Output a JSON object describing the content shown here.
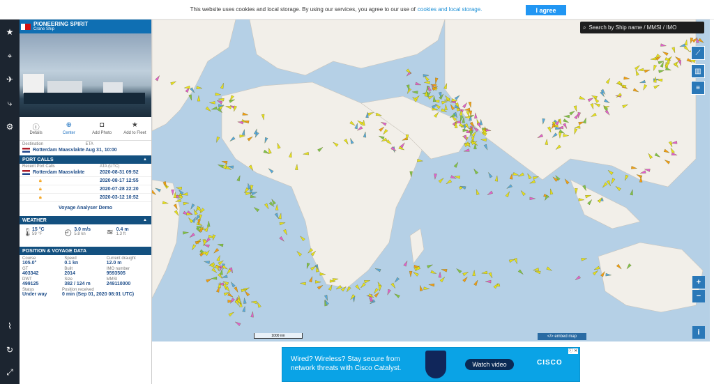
{
  "cookie": {
    "text": "This website uses cookies and local storage. By using our services, you agree to our use of",
    "link": "cookies and local storage.",
    "button": "I agree"
  },
  "left_nav": {
    "icons": [
      "star-icon",
      "location-pin-icon",
      "satellite-icon",
      "route-icon",
      "gear-icon",
      "antenna-icon",
      "refresh-icon",
      "expand-icon"
    ]
  },
  "ship": {
    "name": "PIONEERING SPIRIT",
    "type": "Crane Ship",
    "flag_color": "#d01010"
  },
  "tabs": [
    {
      "label": "Details",
      "icon": "info-icon"
    },
    {
      "label": "Center",
      "icon": "crosshair-icon"
    },
    {
      "label": "Add Photo",
      "icon": "camera-icon"
    },
    {
      "label": "Add to Fleet",
      "icon": "star-icon"
    }
  ],
  "destination": {
    "dest_label": "Destination",
    "eta_label": "ETA",
    "dest_value": "Rotterdam Maasvlakte",
    "eta_value": "Aug 31, 10:00"
  },
  "port_calls": {
    "title": "PORT CALLS",
    "col_port": "Recent Port Calls",
    "col_ata": "ATA (UTC)",
    "rows": [
      {
        "port": "Rotterdam Maasvlakte",
        "time": "2020-08-31 09:52"
      },
      {
        "port": "",
        "time": "2020-08-17 12:55"
      },
      {
        "port": "",
        "time": "2020-07-28 22:20"
      },
      {
        "port": "",
        "time": "2020-03-12 10:52"
      }
    ],
    "link": "Voyage Analyser Demo"
  },
  "weather": {
    "title": "WEATHER",
    "temp_c": "15 °C",
    "temp_f": "59 °F",
    "wind_ms": "3.0 m/s",
    "wind_kn": "5.8 kn",
    "wave_m": "0.4 m",
    "wave_ft": "1.3 ft"
  },
  "voyage": {
    "title": "POSITION & VOYAGE DATA",
    "rows": [
      [
        {
          "label": "Course",
          "value": "105.0°"
        },
        {
          "label": "Speed",
          "value": "0.1 kn"
        },
        {
          "label": "Current draught",
          "value": "12.0 m"
        }
      ],
      [
        {
          "label": "GT",
          "value": "403342"
        },
        {
          "label": "Built",
          "value": "2014"
        },
        {
          "label": "IMO number",
          "value": "9593505"
        }
      ],
      [
        {
          "label": "DWT",
          "value": "499125"
        },
        {
          "label": "Size",
          "value": "382 / 124 m"
        },
        {
          "label": "MMSI",
          "value": "249110000"
        }
      ]
    ],
    "status_label": "Status",
    "status_value": "Under way",
    "position_label": "Position received",
    "position_value": "0 min (Sep 01, 2020 08:01 UTC)"
  },
  "map": {
    "search_placeholder": "Search by Ship name / MMSI / IMO",
    "scale": "1000 nm",
    "embed": "</> embed map",
    "zoom_in": "+",
    "zoom_out": "−",
    "info": "i",
    "ocean_color": "#b5d0e6",
    "land_color": "#f2efe9"
  },
  "ad": {
    "text": "Wired? Wireless? Stay secure from network threats with Cisco Catalyst.",
    "button": "Watch video",
    "logo": "CISCO",
    "close": "ⓘ ✕"
  }
}
